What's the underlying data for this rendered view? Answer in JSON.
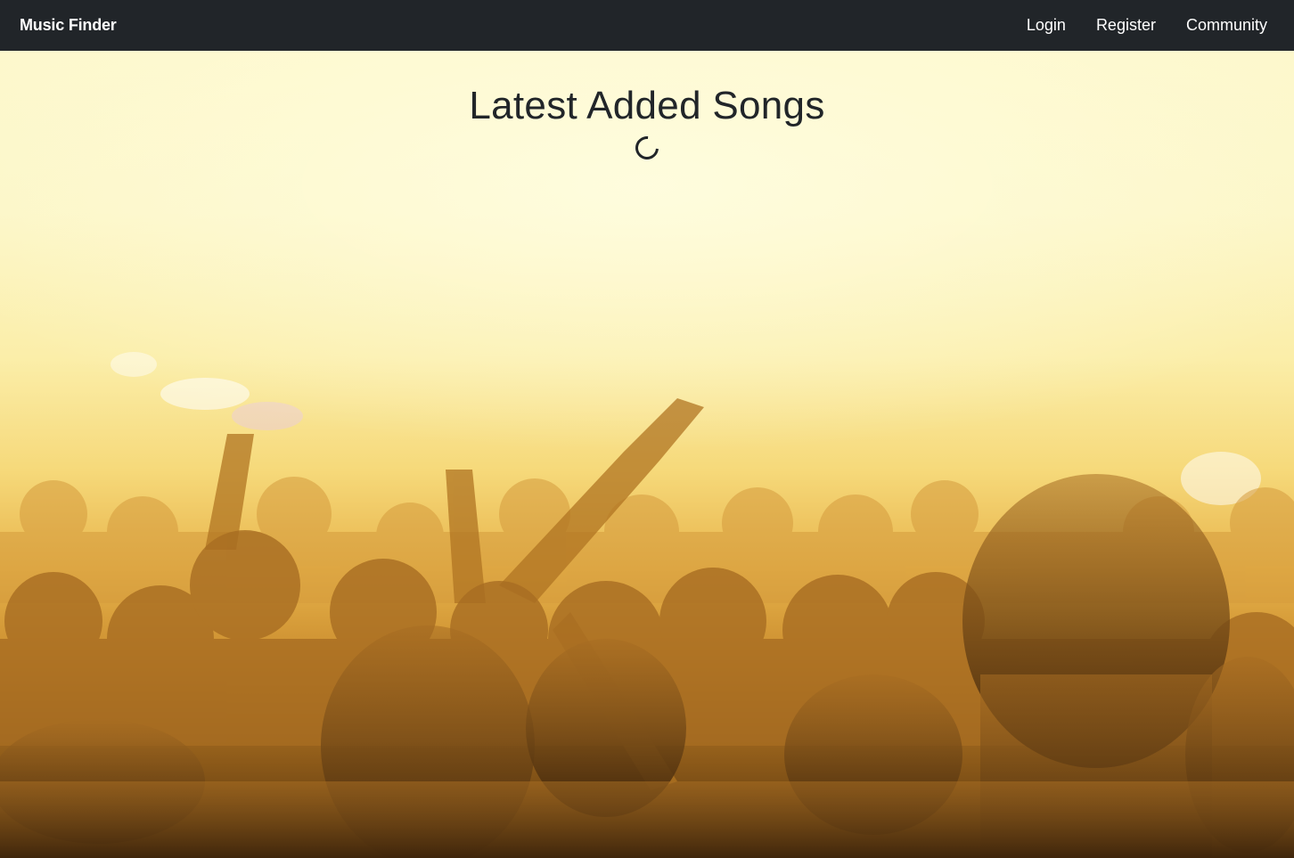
{
  "navbar": {
    "brand": "Music Finder",
    "links": [
      {
        "label": "Login"
      },
      {
        "label": "Register"
      },
      {
        "label": "Community"
      }
    ]
  },
  "main": {
    "title": "Latest Added Songs",
    "loading": true
  },
  "colors": {
    "navbar_bg": "#212529",
    "text_dark": "#212529",
    "hero_light": "#fdf8cc",
    "hero_dark": "#4a2e0c"
  }
}
